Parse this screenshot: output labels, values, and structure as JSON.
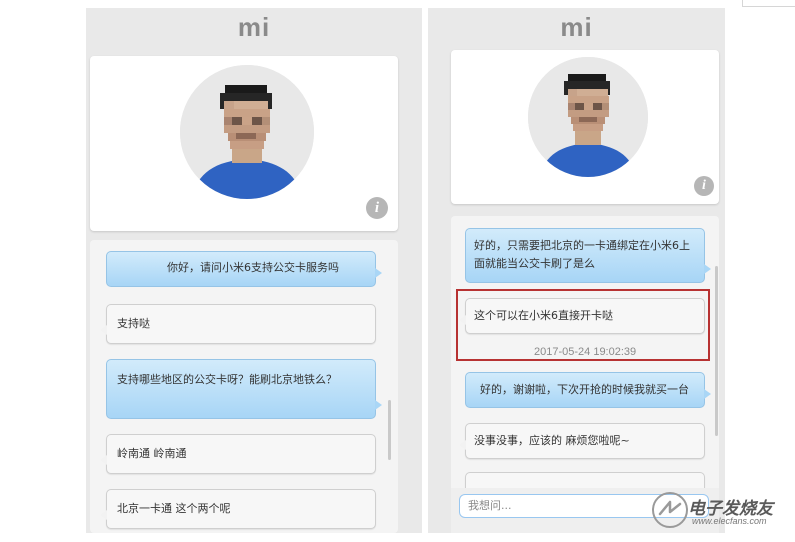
{
  "left_screen": {
    "logo": "mi",
    "info_icon": "i",
    "messages": [
      {
        "side": "out",
        "text": "你好，请问小米6支持公交卡服务吗"
      },
      {
        "side": "in",
        "text": "支持哒"
      },
      {
        "side": "out",
        "text": "支持哪些地区的公交卡呀？能刷北京地铁么？"
      },
      {
        "side": "in",
        "text": "岭南通 岭南通"
      },
      {
        "side": "in",
        "text": "北京一卡通 这个两个呢"
      }
    ]
  },
  "right_screen": {
    "logo": "mi",
    "info_icon": "i",
    "messages": [
      {
        "side": "out",
        "text": "好的，只需要把北京的一卡通绑定在小米6上面就能当公交卡刷了是么"
      },
      {
        "side": "in",
        "text": "这个可以在小米6直接开卡哒"
      },
      {
        "side": "out",
        "text": "好的，谢谢啦，下次开抢的时候我就买一台"
      },
      {
        "side": "in",
        "text": "没事没事，应该的 麻烦您啦呢~"
      }
    ],
    "timestamp": "2017-05-24 19:02:39",
    "input_placeholder": "我想问..."
  },
  "colors": {
    "highlight": "#b73232",
    "outgoing_bubble": "#a7d5f6",
    "incoming_bubble": "#f7f7f7"
  },
  "watermark": {
    "text": "电子发烧友",
    "url": "www.elecfans.com"
  }
}
